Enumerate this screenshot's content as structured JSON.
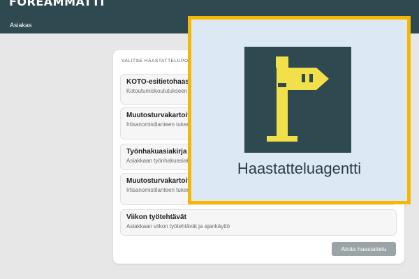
{
  "app": {
    "brand": "FOREAMMATTI",
    "nav": {
      "item": "Asiakas"
    }
  },
  "panel": {
    "section_title": "VALITSE HAASTATTELUPOHJA",
    "options": [
      {
        "title": "KOTO-esitietohaastattelu",
        "desc": "Kotoutumiskoulutukseen ohjattavan asiakkaan esitiedot työvoimaviranomaiselle"
      },
      {
        "title": "Muutosturvakartoitus",
        "desc": "Irtisanomistilanteen tukena kartoitus, jonka avulla voidaan kerätä valmentajalle pohjatiedot"
      },
      {
        "title": "Työnhakuasiakirja",
        "desc": "Asiakkaan työnhakuasiakirjan tiedot"
      },
      {
        "title": "Muutosturvakartoitus",
        "desc": "Irtisanomistilanteen tukena kartoitus, jonka avulla voidaan kerätä valmentajalle pohjatiedot"
      },
      {
        "title": "Viikon työtehtävät",
        "desc": "Asiakkaan viikon työtehtävät ja ajankäyttö"
      }
    ],
    "start_button": "Aloita haastattelu"
  },
  "overlay": {
    "title": "Haastatteluagentti",
    "icon": "signpost-icon"
  },
  "colors": {
    "topbar": "#2e4a50",
    "accent_yellow": "#f2e04a",
    "overlay_border": "#f5b800",
    "overlay_bg": "#dce9f5",
    "button_disabled": "#9aa3a6"
  }
}
